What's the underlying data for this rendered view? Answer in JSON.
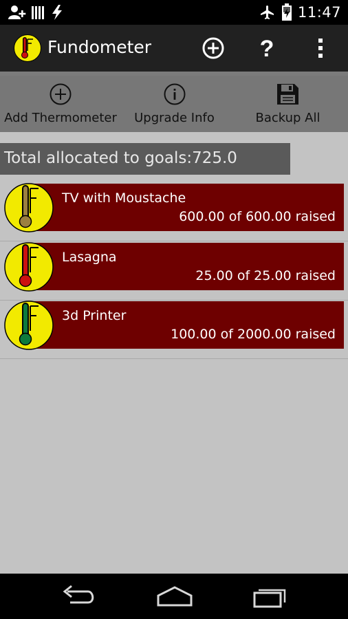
{
  "status_bar": {
    "time": "11:47",
    "icons": [
      "add-user-icon",
      "signal-bars-icon",
      "flash-icon",
      "airplane-icon",
      "battery-charging-icon"
    ]
  },
  "action_bar": {
    "title": "Fundometer",
    "actions": [
      "add-icon",
      "help-icon",
      "overflow-menu-icon"
    ],
    "help_label": "?"
  },
  "toolbar": {
    "add_label": "Add Thermometer",
    "upgrade_label": "Upgrade Info",
    "backup_label": "Backup All"
  },
  "summary": {
    "total_text": "Total allocated to goals:725.0"
  },
  "goals": [
    {
      "name": "TV with Moustache",
      "progress_text": "600.00 of 600.00 raised",
      "raised": 600.0,
      "target": 600.0,
      "thermometer_color": "#9b8040"
    },
    {
      "name": "Lasagna",
      "progress_text": "25.00 of 25.00 raised",
      "raised": 25.0,
      "target": 25.0,
      "thermometer_color": "#cc1010"
    },
    {
      "name": "3d Printer",
      "progress_text": "100.00 of 2000.00 raised",
      "raised": 100.0,
      "target": 2000.0,
      "thermometer_color": "#0e7a3c"
    }
  ],
  "nav_bar": {
    "buttons": [
      "back-icon",
      "home-icon",
      "recent-apps-icon"
    ]
  },
  "colors": {
    "background": "#c3c3c3",
    "goal_bar": "#6e0000",
    "icon_circle": "#f2ea00",
    "action_bar": "#212121",
    "toolbar": "#777777"
  }
}
